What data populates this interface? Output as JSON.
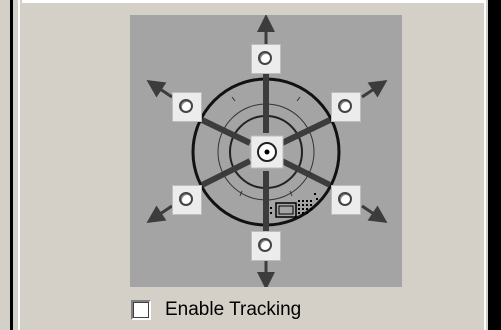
{
  "tracking": {
    "checkbox_label": "Enable Tracking",
    "checked": false
  },
  "direction_selector": {
    "options": [
      "up",
      "up-right",
      "down-right",
      "down",
      "down-left",
      "up-left",
      "center"
    ],
    "selected": "center"
  },
  "colors": {
    "panel_background": "#d4d0c8",
    "diagram_background": "#a4a4a4",
    "arrow_color": "#3c3c3c"
  }
}
